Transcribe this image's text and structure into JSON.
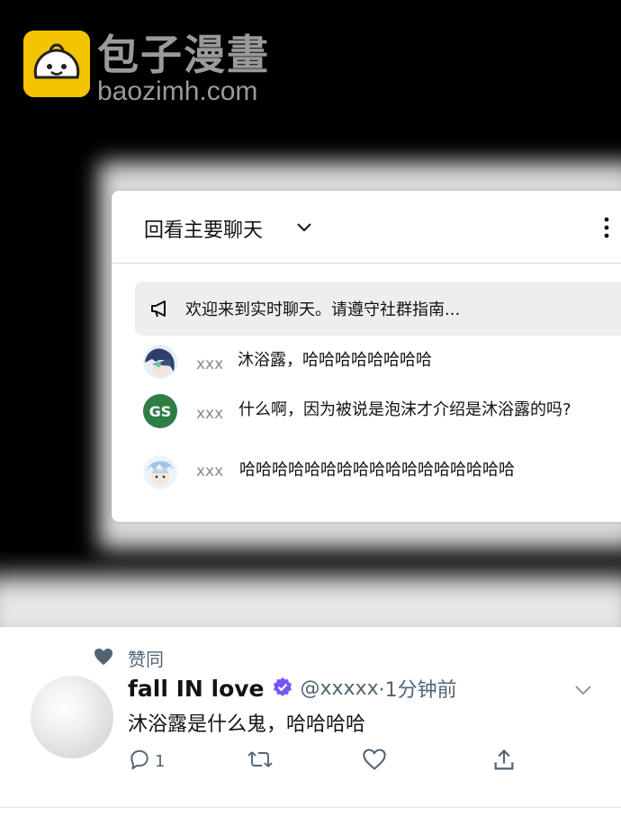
{
  "watermark": {
    "title": "包子漫畫",
    "url": "baozimh.com",
    "logo_color": "#f5c400"
  },
  "chat": {
    "header_title": "回看主要聊天",
    "header_icons": [
      "chevron-down-icon",
      "more-vertical-icon"
    ],
    "pinned_icon": "megaphone-icon",
    "pinned_text": "欢迎来到实时聊天。请遵守社群指南...",
    "messages": [
      {
        "avatar": "anime-avatar",
        "user": "xxx",
        "text": "沐浴露，哈哈哈哈哈哈哈哈"
      },
      {
        "avatar_initials": "GS",
        "avatar_color": "#2e7d45",
        "user": "xxx",
        "text": "什么啊，因为被说是泡沫才介绍是沐浴露的吗?"
      },
      {
        "avatar": "anime-avatar",
        "user": "xxx",
        "text": "哈哈哈哈哈哈哈哈哈哈哈哈哈哈哈哈哈"
      }
    ]
  },
  "tweet": {
    "liked_label": "赞同",
    "name": "fall IN love",
    "verified_color": "#7856ff",
    "handle": "@xxxxx",
    "time": "·1分钟前",
    "body": "沐浴露是什么鬼，哈哈哈哈",
    "reply_count": "1",
    "action_icons": [
      "reply-icon",
      "retweet-icon",
      "like-icon",
      "share-icon"
    ]
  }
}
